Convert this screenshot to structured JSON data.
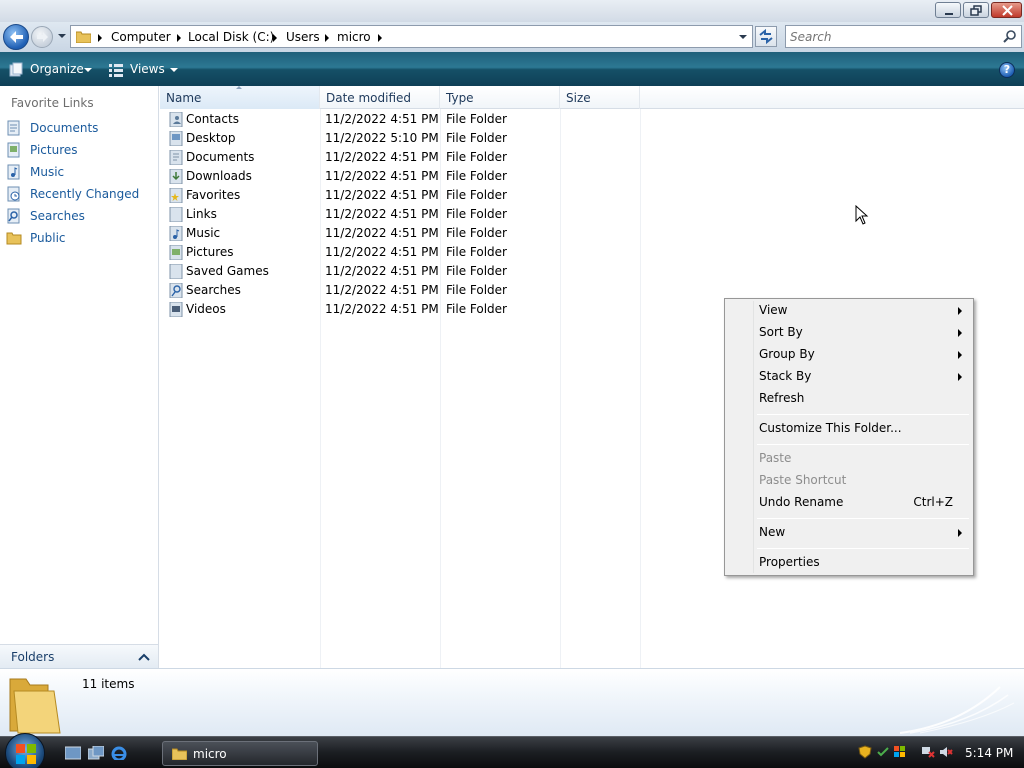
{
  "window": {
    "title_buttons": [
      "minimize",
      "maximize",
      "close"
    ]
  },
  "address": {
    "crumbs": [
      "Computer",
      "Local Disk (C:)",
      "Users",
      "micro"
    ],
    "search_placeholder": "Search"
  },
  "toolbar": {
    "organize_label": "Organize",
    "views_label": "Views",
    "help_label": "?"
  },
  "nav": {
    "header": "Favorite Links",
    "links": [
      {
        "label": "Documents",
        "icon": "documents-icon"
      },
      {
        "label": "Pictures",
        "icon": "pictures-icon"
      },
      {
        "label": "Music",
        "icon": "music-icon"
      },
      {
        "label": "Recently Changed",
        "icon": "recently-changed-icon"
      },
      {
        "label": "Searches",
        "icon": "searches-icon"
      },
      {
        "label": "Public",
        "icon": "public-folder-icon"
      }
    ],
    "folders_label": "Folders"
  },
  "filelist": {
    "columns": [
      "Name",
      "Date modified",
      "Type",
      "Size"
    ],
    "rows": [
      {
        "name": "Contacts",
        "date": "11/2/2022 4:51 PM",
        "type": "File Folder"
      },
      {
        "name": "Desktop",
        "date": "11/2/2022 5:10 PM",
        "type": "File Folder"
      },
      {
        "name": "Documents",
        "date": "11/2/2022 4:51 PM",
        "type": "File Folder"
      },
      {
        "name": "Downloads",
        "date": "11/2/2022 4:51 PM",
        "type": "File Folder"
      },
      {
        "name": "Favorites",
        "date": "11/2/2022 4:51 PM",
        "type": "File Folder"
      },
      {
        "name": "Links",
        "date": "11/2/2022 4:51 PM",
        "type": "File Folder"
      },
      {
        "name": "Music",
        "date": "11/2/2022 4:51 PM",
        "type": "File Folder"
      },
      {
        "name": "Pictures",
        "date": "11/2/2022 4:51 PM",
        "type": "File Folder"
      },
      {
        "name": "Saved Games",
        "date": "11/2/2022 4:51 PM",
        "type": "File Folder"
      },
      {
        "name": "Searches",
        "date": "11/2/2022 4:51 PM",
        "type": "File Folder"
      },
      {
        "name": "Videos",
        "date": "11/2/2022 4:51 PM",
        "type": "File Folder"
      }
    ]
  },
  "context_menu": {
    "view": "View",
    "sort_by": "Sort By",
    "group_by": "Group By",
    "stack_by": "Stack By",
    "refresh": "Refresh",
    "customize": "Customize This Folder...",
    "paste": "Paste",
    "paste_shortcut": "Paste Shortcut",
    "undo_rename": "Undo Rename",
    "undo_shortcut": "Ctrl+Z",
    "new": "New",
    "properties": "Properties"
  },
  "details": {
    "item_count": "11 items"
  },
  "taskbar": {
    "window_button": "micro",
    "clock": "5:14 PM"
  },
  "colors": {
    "link_blue": "#1a5a9c",
    "command_bar": "#1f5f7a",
    "close_red": "#c0392b"
  }
}
